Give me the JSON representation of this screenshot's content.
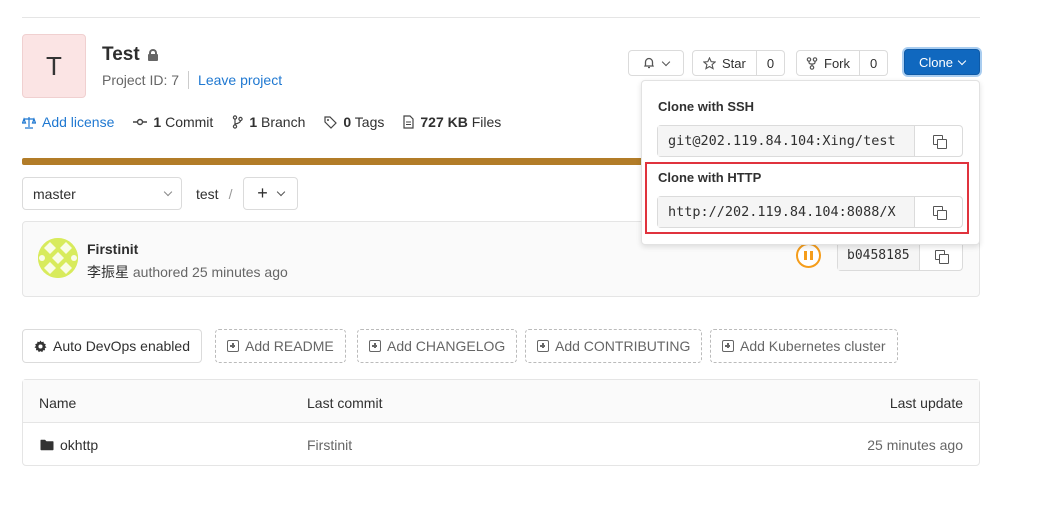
{
  "project": {
    "avatar_letter": "T",
    "title": "Test",
    "id_text": "Project ID: 7",
    "leave_label": "Leave project"
  },
  "header_buttons": {
    "star_label": "Star",
    "star_count": "0",
    "fork_label": "Fork",
    "fork_count": "0",
    "clone_label": "Clone"
  },
  "stats": {
    "add_license": "Add license",
    "commit_count": "1",
    "commit_label": "Commit",
    "branch_count": "1",
    "branch_label": "Branch",
    "tags_count": "0",
    "tags_label": "Tags",
    "files_size": "727 KB",
    "files_label": "Files"
  },
  "progress": {
    "fraction": 1.0,
    "color": "#b27c28"
  },
  "nav": {
    "branch": "master",
    "path": "test",
    "separator": "/"
  },
  "commit": {
    "title": "Firstinit",
    "author": "李振星",
    "meta": "authored 25 minutes ago",
    "sha": "b0458185"
  },
  "actions": [
    {
      "label": "Auto DevOps enabled",
      "style": "solid"
    },
    {
      "label": "Add README",
      "style": "dashed"
    },
    {
      "label": "Add CHANGELOG",
      "style": "dashed"
    },
    {
      "label": "Add CONTRIBUTING",
      "style": "dashed"
    },
    {
      "label": "Add Kubernetes cluster",
      "style": "dashed"
    }
  ],
  "table": {
    "headers": [
      "Name",
      "Last commit",
      "Last update"
    ],
    "rows": [
      {
        "name": "okhttp",
        "last_commit": "Firstinit",
        "last_update": "25 minutes ago"
      }
    ]
  },
  "clone_dropdown": {
    "ssh_label": "Clone with SSH",
    "ssh_url": "git@202.119.84.104:Xing/test",
    "http_label": "Clone with HTTP",
    "http_url": "http://202.119.84.104:8088/X"
  },
  "colors": {
    "accent": "#1068bf",
    "link": "#1f78d1",
    "highlight": "#e0333d",
    "pipeline": "#f59d1b"
  }
}
